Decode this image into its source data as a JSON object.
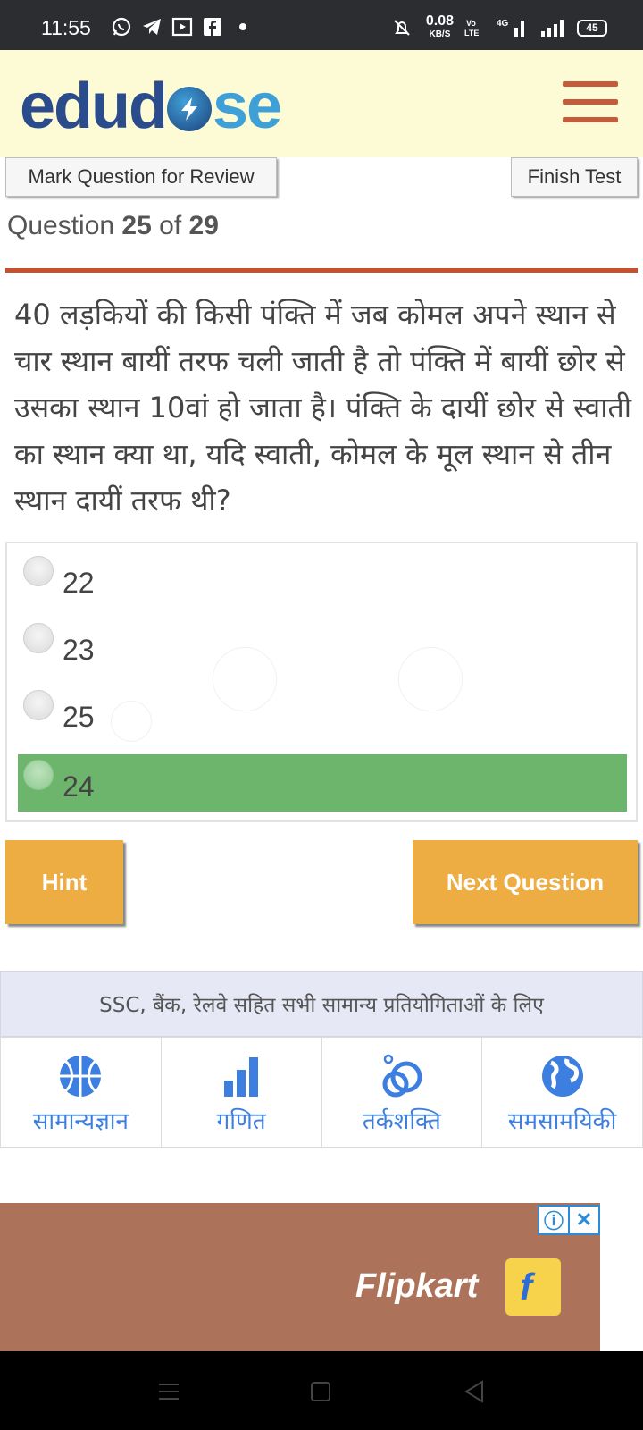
{
  "status_bar": {
    "time": "11:55",
    "speed_value": "0.08",
    "speed_unit": "KB/S",
    "network": "4G",
    "battery": "45"
  },
  "header": {
    "logo_part1": "edud",
    "logo_part2": "se",
    "menu_icon": "hamburger-icon"
  },
  "toolbar": {
    "mark_review": "Mark Question for Review",
    "finish_test": "Finish Test"
  },
  "question": {
    "label": "Question",
    "current": "25",
    "of_label": "of",
    "total": "29",
    "text": "40 लड़कियों की किसी पंक्ति में जब कोमल अपने स्थान से चार स्थान बायीं तरफ चली जाती है तो पंक्ति में बायीं छोर से उसका स्थान 10वां हो जाता है। पंक्ति के दायीं छोर से स्वाती का स्थान क्या था, यदि स्वाती, कोमल के मूल स्थान से तीन स्थान दायीं तरफ थी?"
  },
  "options": [
    {
      "label": "22",
      "selected": false
    },
    {
      "label": "23",
      "selected": false
    },
    {
      "label": "25",
      "selected": false
    },
    {
      "label": "24",
      "selected": true
    }
  ],
  "actions": {
    "hint": "Hint",
    "next": "Next Question"
  },
  "categories": {
    "banner": "SSC, बैंक, रेलवे सहित सभी सामान्य प्रतियोगिताओं के लिए",
    "items": [
      {
        "label": "सामान्यज्ञान",
        "icon": "basketball-icon"
      },
      {
        "label": "गणित",
        "icon": "bar-chart-icon"
      },
      {
        "label": "तर्कशक्ति",
        "icon": "rings-icon"
      },
      {
        "label": "समसामयिकी",
        "icon": "globe-icon"
      }
    ]
  },
  "ad": {
    "brand": "Flipkart",
    "info_icon": "info-icon",
    "close_icon": "close-icon"
  },
  "colors": {
    "accent_orange": "#edad43",
    "selected_green": "#6db56d",
    "divider": "#c8502f",
    "header_bg": "#fdfbd5",
    "link_blue": "#3d7fe0"
  }
}
